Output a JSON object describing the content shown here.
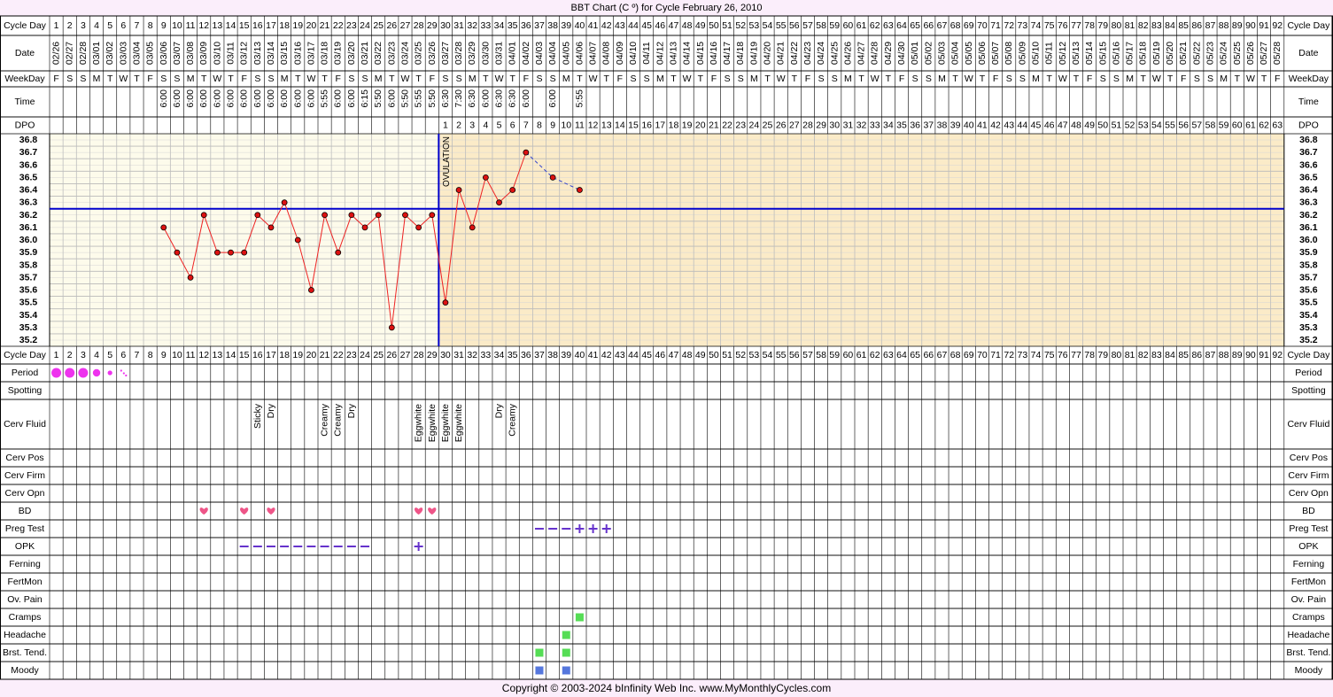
{
  "title": "BBT Chart (C º) for Cycle February 26, 2010",
  "copyright": "Copyright © 2003-2024 bInfinity Web Inc.     www.MyMonthlyCycles.com",
  "row_labels": {
    "cycle_day": "Cycle Day",
    "date": "Date",
    "weekday": "WeekDay",
    "time": "Time",
    "dpo": "DPO",
    "period": "Period",
    "spotting": "Spotting",
    "cerv_fluid": "Cerv Fluid",
    "cerv_pos": "Cerv Pos",
    "cerv_firm": "Cerv Firm",
    "cerv_opn": "Cerv Opn",
    "bd": "BD",
    "preg_test": "Preg Test",
    "opk": "OPK",
    "ferning": "Ferning",
    "fertmon": "FertMon",
    "ov_pain": "Ov. Pain",
    "cramps": "Cramps",
    "headache": "Headache",
    "brst_tend": "Brst. Tend.",
    "moody": "Moody"
  },
  "ovulation_label": "OVULATION",
  "colors": {
    "background": "#fbeefb",
    "grid_line": "#000000",
    "pre_ovulation_fill": "#fdfbeb",
    "post_ovulation_fill": "#fbebc8",
    "temp_line": "#ee2222",
    "temp_point": "#dd1111",
    "coverline": "#0000cc",
    "ovulation_line": "#0000cc",
    "projection": "#3344cc",
    "period_dot": "#ee33ee",
    "bd_heart": "#ee5588",
    "test_symbol": "#6633cc",
    "cramps_headache_brst": "#55dd55",
    "moody": "#5577dd"
  },
  "chart_data": {
    "type": "line",
    "title": "BBT Chart (C º) for Cycle February 26, 2010",
    "cycle_days": [
      1,
      2,
      3,
      4,
      5,
      6,
      7,
      8,
      9,
      10,
      11,
      12,
      13,
      14,
      15,
      16,
      17,
      18,
      19,
      20,
      21,
      22,
      23,
      24,
      25,
      26,
      27,
      28,
      29,
      30,
      31,
      32,
      33,
      34,
      35,
      36,
      37,
      38,
      39,
      40,
      41,
      42,
      43,
      44,
      45,
      46,
      47,
      48,
      49,
      50,
      51,
      52,
      53,
      54,
      55,
      56,
      57,
      58,
      59,
      60,
      61,
      62,
      63,
      64,
      65,
      66,
      67,
      68,
      69,
      70,
      71,
      72,
      73,
      74,
      75,
      76,
      77,
      78,
      79,
      80,
      81,
      82,
      83,
      84,
      85,
      86,
      87,
      88,
      89,
      90,
      91,
      92
    ],
    "dates": [
      "02/26",
      "02/27",
      "02/28",
      "03/01",
      "03/02",
      "03/03",
      "03/04",
      "03/05",
      "03/06",
      "03/07",
      "03/08",
      "03/09",
      "03/10",
      "03/11",
      "03/12",
      "03/13",
      "03/14",
      "03/15",
      "03/16",
      "03/17",
      "03/18",
      "03/19",
      "03/20",
      "03/21",
      "03/22",
      "03/23",
      "03/24",
      "03/25",
      "03/26",
      "03/27",
      "03/28",
      "03/29",
      "03/30",
      "03/31",
      "04/01",
      "04/02",
      "04/03",
      "04/04",
      "04/05",
      "04/06",
      "04/07",
      "04/08",
      "04/09",
      "04/10",
      "04/11",
      "04/12",
      "04/13",
      "04/14",
      "04/15",
      "04/16",
      "04/17",
      "04/18",
      "04/19",
      "04/20",
      "04/21",
      "04/22",
      "04/23",
      "04/24",
      "04/25",
      "04/26",
      "04/27",
      "04/28",
      "04/29",
      "04/30",
      "05/01",
      "05/02",
      "05/03",
      "05/04",
      "05/05",
      "05/06",
      "05/07",
      "05/08",
      "05/09",
      "05/10",
      "05/11",
      "05/12",
      "05/13",
      "05/14",
      "05/15",
      "05/16",
      "05/17",
      "05/18",
      "05/19",
      "05/20",
      "05/21",
      "05/22",
      "05/23",
      "05/24",
      "05/25",
      "05/26",
      "05/27",
      "05/28"
    ],
    "weekdays": [
      "F",
      "S",
      "S",
      "M",
      "T",
      "W",
      "T",
      "F",
      "S",
      "S",
      "M",
      "T",
      "W",
      "T",
      "F",
      "S",
      "S",
      "M",
      "T",
      "W",
      "T",
      "F",
      "S",
      "S",
      "M",
      "T",
      "W",
      "T",
      "F",
      "S",
      "S",
      "M",
      "T",
      "W",
      "T",
      "F",
      "S",
      "S",
      "M",
      "T",
      "W",
      "T",
      "F",
      "S",
      "S",
      "M",
      "T",
      "W",
      "T",
      "F",
      "S",
      "S",
      "M",
      "T",
      "W",
      "T",
      "F",
      "S",
      "S",
      "M",
      "T",
      "W",
      "T",
      "F",
      "S",
      "S",
      "M",
      "T",
      "W",
      "T",
      "F",
      "S",
      "S",
      "M",
      "T",
      "W",
      "T",
      "F",
      "S",
      "S",
      "M",
      "T",
      "W",
      "T",
      "F",
      "S",
      "S",
      "M",
      "T",
      "W",
      "T",
      "F"
    ],
    "times": [
      null,
      null,
      null,
      null,
      null,
      null,
      null,
      null,
      "6:00",
      "6:00",
      "6:00",
      "6:00",
      "6:00",
      "6:00",
      "6:00",
      "6:00",
      "6:00",
      "6:00",
      "6:00",
      "6:00",
      "5:55",
      "6:00",
      "6:00",
      "6:15",
      "5:50",
      "6:00",
      "5:50",
      "5:55",
      "5:50",
      "6:30",
      "7:30",
      "6:30",
      "6:00",
      "6:30",
      "6:30",
      "6:00",
      null,
      "6:00",
      null,
      "5:55"
    ],
    "dpo": [
      "1",
      "2",
      "3",
      "4",
      "5",
      "6",
      "7",
      "8",
      "9",
      "10",
      "11",
      "12",
      "13",
      "14",
      "15",
      "16",
      "17",
      "18",
      "19",
      "20",
      "21",
      "22",
      "23",
      "24",
      "25",
      "26",
      "27",
      "28",
      "29",
      "30",
      "31",
      "32",
      "33",
      "34",
      "35",
      "36",
      "37",
      "38",
      "39",
      "40",
      "41",
      "42",
      "43",
      "44",
      "45",
      "46",
      "47",
      "48",
      "49",
      "50",
      "51",
      "52",
      "53",
      "54",
      "55",
      "56",
      "57",
      "58",
      "59",
      "60",
      "61",
      "62",
      "63"
    ],
    "dpo_start_day": 30,
    "temperatures": [
      {
        "day": 9,
        "temp": 36.1
      },
      {
        "day": 10,
        "temp": 35.9
      },
      {
        "day": 11,
        "temp": 35.7
      },
      {
        "day": 12,
        "temp": 36.2
      },
      {
        "day": 13,
        "temp": 35.9
      },
      {
        "day": 14,
        "temp": 35.9
      },
      {
        "day": 15,
        "temp": 35.9
      },
      {
        "day": 16,
        "temp": 36.2
      },
      {
        "day": 17,
        "temp": 36.1
      },
      {
        "day": 18,
        "temp": 36.3
      },
      {
        "day": 19,
        "temp": 36.0
      },
      {
        "day": 20,
        "temp": 35.6
      },
      {
        "day": 21,
        "temp": 36.2
      },
      {
        "day": 22,
        "temp": 35.9
      },
      {
        "day": 23,
        "temp": 36.2
      },
      {
        "day": 24,
        "temp": 36.1
      },
      {
        "day": 25,
        "temp": 36.2
      },
      {
        "day": 26,
        "temp": 35.3
      },
      {
        "day": 27,
        "temp": 36.2
      },
      {
        "day": 28,
        "temp": 36.1
      },
      {
        "day": 29,
        "temp": 36.2
      },
      {
        "day": 30,
        "temp": 35.5
      },
      {
        "day": 31,
        "temp": 36.4
      },
      {
        "day": 32,
        "temp": 36.1
      },
      {
        "day": 33,
        "temp": 36.5
      },
      {
        "day": 34,
        "temp": 36.3
      },
      {
        "day": 35,
        "temp": 36.4
      },
      {
        "day": 36,
        "temp": 36.7
      }
    ],
    "projected": [
      {
        "day": 36,
        "temp": 36.7
      },
      {
        "day": 38,
        "temp": 36.5
      },
      {
        "day": 40,
        "temp": 36.4
      }
    ],
    "projected_points": [
      {
        "day": 38,
        "temp": 36.5
      },
      {
        "day": 40,
        "temp": 36.4
      }
    ],
    "y_ticks": [
      "36.8",
      "36.7",
      "36.6",
      "36.5",
      "36.4",
      "36.3",
      "36.2",
      "36.1",
      "36.0",
      "35.9",
      "35.8",
      "35.7",
      "35.6",
      "35.5",
      "35.4",
      "35.3",
      "35.2"
    ],
    "ylim": [
      35.2,
      36.8
    ],
    "coverline": 36.25,
    "ovulation_day": 29,
    "period": [
      {
        "day": 1,
        "level": "heavy"
      },
      {
        "day": 2,
        "level": "heavy"
      },
      {
        "day": 3,
        "level": "heavy"
      },
      {
        "day": 4,
        "level": "medium"
      },
      {
        "day": 5,
        "level": "light"
      },
      {
        "day": 6,
        "level": "spotting"
      }
    ],
    "cervical_fluid": [
      {
        "day": 16,
        "value": "Sticky"
      },
      {
        "day": 17,
        "value": "Dry"
      },
      {
        "day": 21,
        "value": "Creamy"
      },
      {
        "day": 22,
        "value": "Creamy"
      },
      {
        "day": 23,
        "value": "Dry"
      },
      {
        "day": 28,
        "value": "Eggwhite"
      },
      {
        "day": 29,
        "value": "Eggwhite"
      },
      {
        "day": 30,
        "value": "Eggwhite"
      },
      {
        "day": 31,
        "value": "Eggwhite"
      },
      {
        "day": 34,
        "value": "Dry"
      },
      {
        "day": 35,
        "value": "Creamy"
      }
    ],
    "bd_days": [
      12,
      15,
      17,
      28,
      29
    ],
    "preg_test": [
      {
        "day": 37,
        "result": "negative"
      },
      {
        "day": 38,
        "result": "negative"
      },
      {
        "day": 39,
        "result": "negative"
      },
      {
        "day": 40,
        "result": "positive"
      },
      {
        "day": 41,
        "result": "positive"
      },
      {
        "day": 42,
        "result": "positive"
      }
    ],
    "opk": [
      {
        "day": 15,
        "result": "negative"
      },
      {
        "day": 16,
        "result": "negative"
      },
      {
        "day": 17,
        "result": "negative"
      },
      {
        "day": 18,
        "result": "negative"
      },
      {
        "day": 19,
        "result": "negative"
      },
      {
        "day": 20,
        "result": "negative"
      },
      {
        "day": 21,
        "result": "negative"
      },
      {
        "day": 22,
        "result": "negative"
      },
      {
        "day": 23,
        "result": "negative"
      },
      {
        "day": 24,
        "result": "negative"
      },
      {
        "day": 28,
        "result": "positive"
      }
    ],
    "cramps_days": [
      40
    ],
    "headache_days": [
      39
    ],
    "brst_tend_days": [
      37,
      39
    ],
    "moody_days": [
      37,
      39
    ]
  }
}
